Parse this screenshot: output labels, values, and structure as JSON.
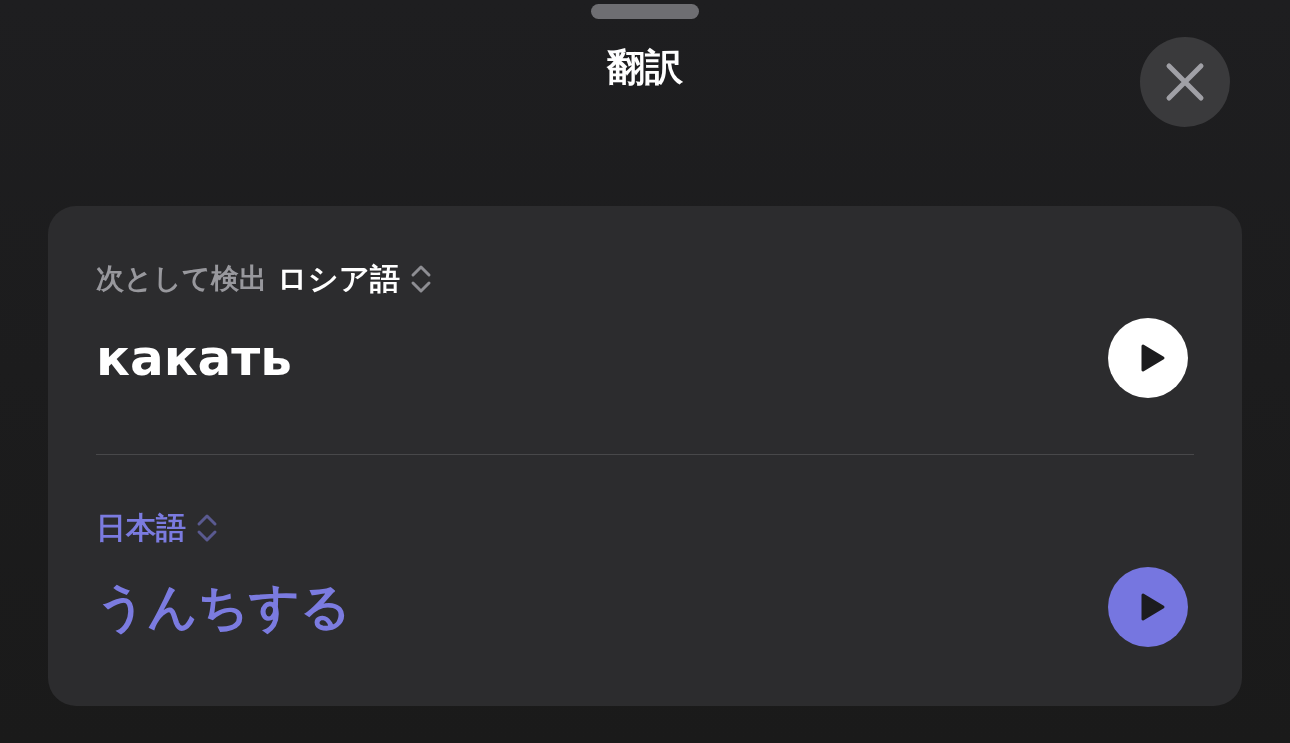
{
  "title": "翻訳",
  "source": {
    "detected_label": "次として検出",
    "language": "ロシア語",
    "text": "какать"
  },
  "target": {
    "language": "日本語",
    "text": "うんちする"
  }
}
